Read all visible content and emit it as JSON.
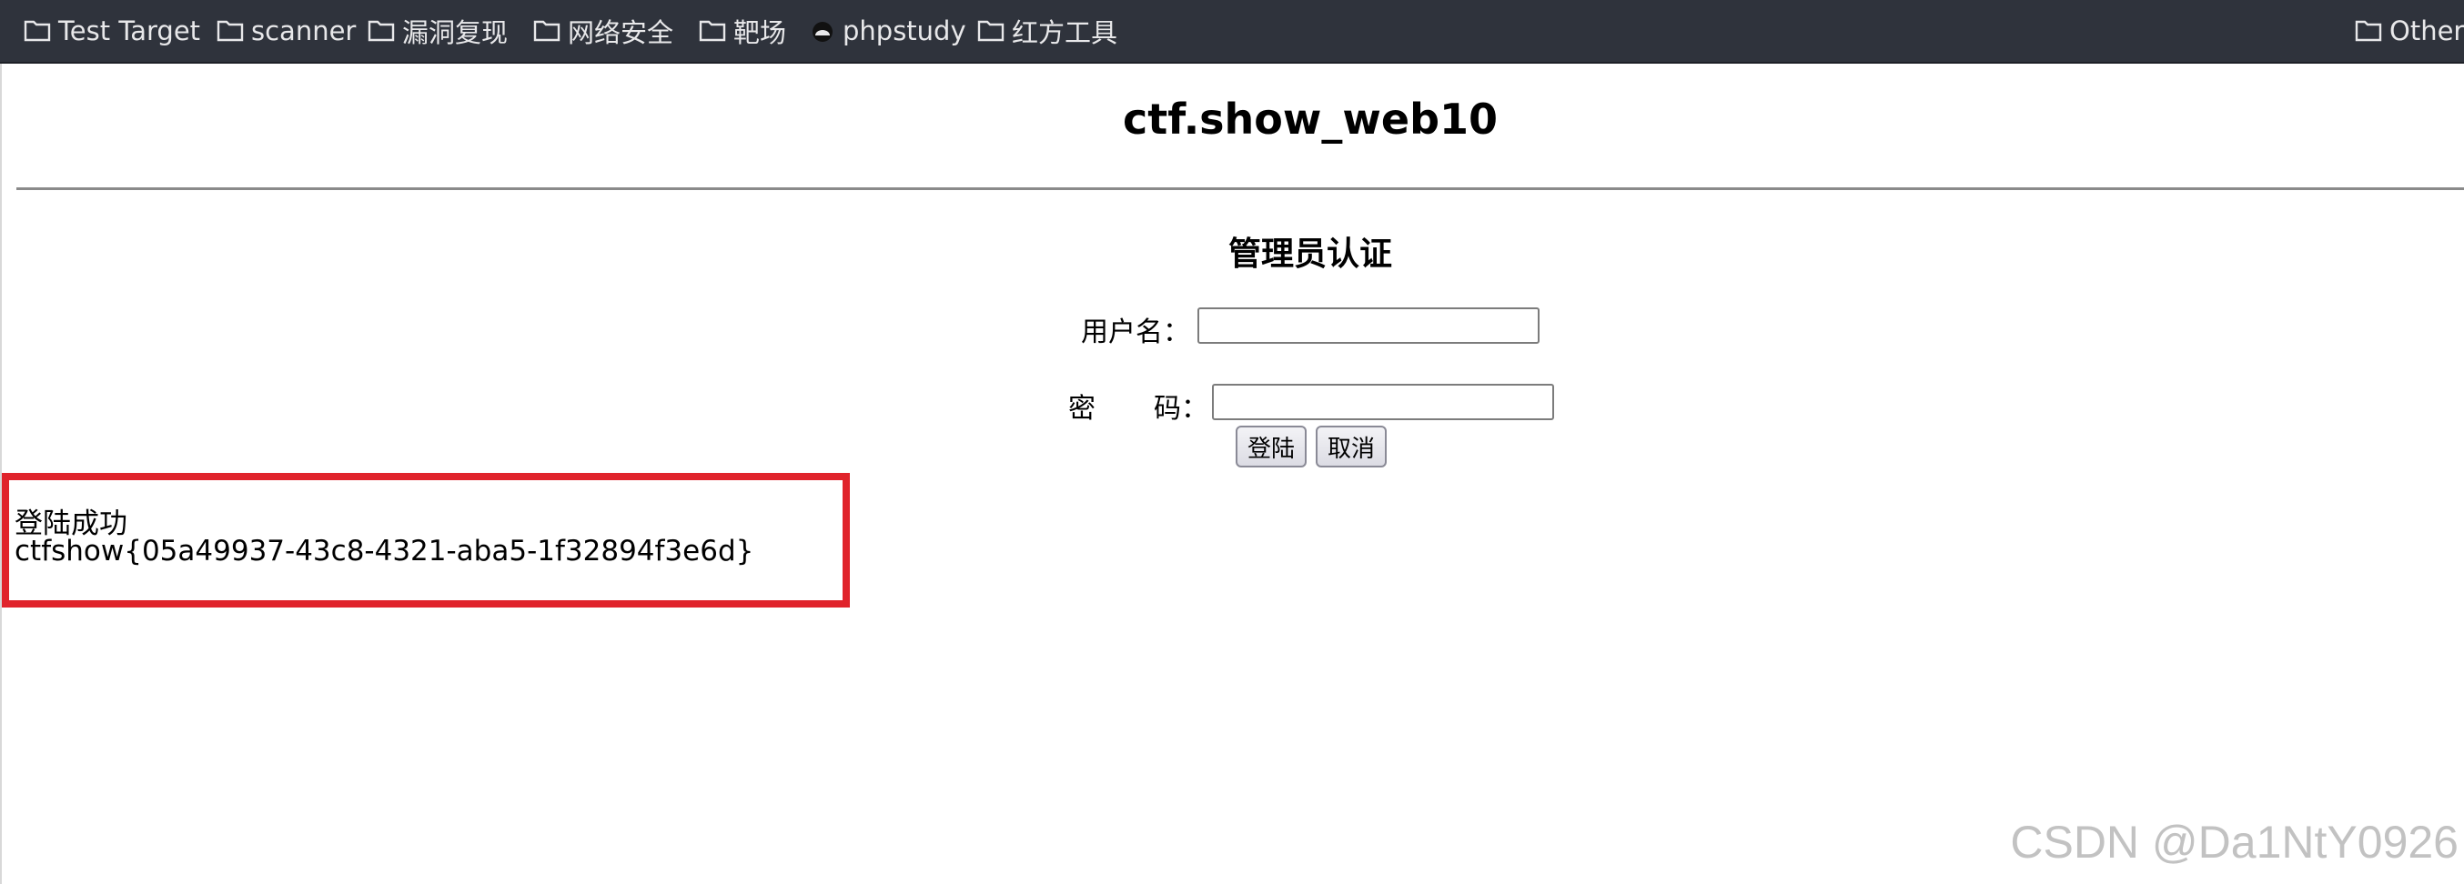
{
  "bookmarks": [
    {
      "label": "Test Target",
      "icon": "folder-icon"
    },
    {
      "label": "scanner",
      "icon": "folder-icon"
    },
    {
      "label": "漏洞复现",
      "icon": "folder-icon"
    },
    {
      "label": "网络安全",
      "icon": "folder-icon"
    },
    {
      "label": "靶场",
      "icon": "folder-icon"
    },
    {
      "label": "phpstudy",
      "icon": "phpstudy-icon"
    },
    {
      "label": "红方工具",
      "icon": "folder-icon"
    },
    {
      "label": "Other",
      "icon": "folder-icon"
    }
  ],
  "page": {
    "title": "ctf.show_web10"
  },
  "form": {
    "title": "管理员认证",
    "username_label": "用户名：",
    "username_value": "",
    "password_label_left": "密",
    "password_label_right": "码：",
    "password_value": "",
    "login_button": "登陆",
    "cancel_button": "取消"
  },
  "result": {
    "status": "登陆成功",
    "flag": "ctfshow{05a49937-43c8-4321-aba5-1f32894f3e6d}"
  },
  "watermark": "CSDN @Da1NtY0926",
  "colors": {
    "toolbar": "#2f333c",
    "highlight_box": "#e0232b"
  }
}
